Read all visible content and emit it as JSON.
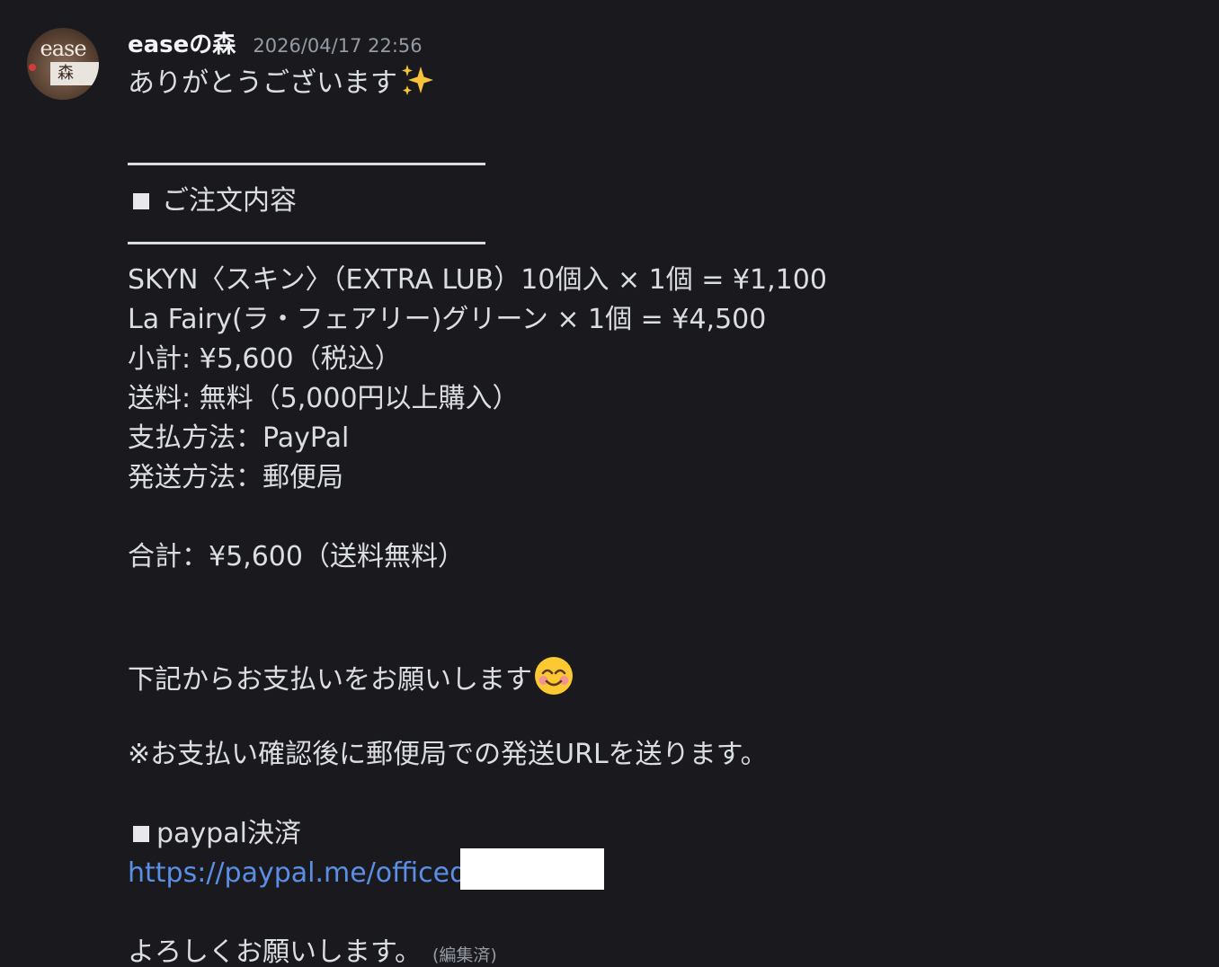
{
  "message": {
    "avatar": {
      "top_text": "ease",
      "box_text": "森"
    },
    "username": "easeの森",
    "timestamp": "2026/04/17 22:56",
    "lines": {
      "thanks": "ありがとうございます",
      "order_heading": "ご注文内容",
      "item1": "SKYN〈スキン〉（EXTRA LUB）10個入 × 1個 = ¥1,100",
      "item2": "La Fairy(ラ・フェアリー)グリーン × 1個 = ¥4,500",
      "subtotal": "小計: ¥5,600（税込）",
      "shipping_fee": "送料: 無料（5,000円以上購入）",
      "payment_method": "支払方法：PayPal",
      "shipping_method": "発送方法：郵便局",
      "total": "合計：¥5,600（送料無料）",
      "pay_request": "下記からお支払いをお願いします",
      "note": "※お支払い確認後に郵便局での発送URLを送ります。",
      "paypal_heading": "paypal決済",
      "paypal_link": "https://paypal.me/officed/5",
      "closing": "よろしくお願いします。",
      "edited": "(編集済)"
    },
    "emojis": {
      "sparkles": "sparkles-icon",
      "smile": "smiling-face-icon"
    }
  }
}
